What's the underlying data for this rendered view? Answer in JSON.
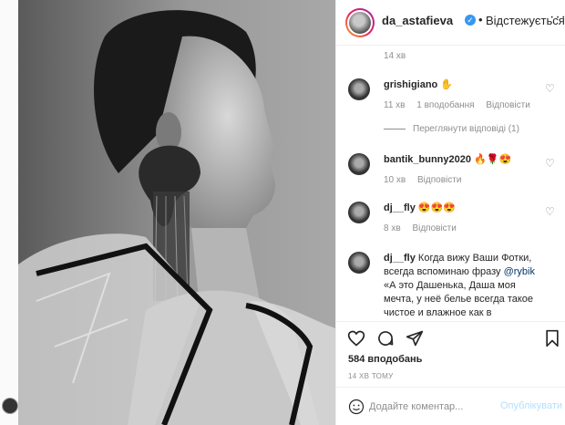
{
  "header": {
    "username": "da_astafieva",
    "separator": "•",
    "follow_status": "Відстежується",
    "more": "···"
  },
  "comments": {
    "top_timestamp": "14 хв",
    "items": [
      {
        "username": "grishigiano",
        "text": "✋",
        "time": "11 хв",
        "likes": "1 вподобання",
        "reply": "Відповісти",
        "view_replies": "Переглянути відповіді (1)"
      },
      {
        "username": "bantik_bunny2020",
        "text": "🔥🌹😍",
        "time": "10 хв",
        "reply": "Відповісти"
      },
      {
        "username": "dj__fly",
        "text": "😍😍😍",
        "time": "8 хв",
        "reply": "Відповісти"
      },
      {
        "username": "dj__fly",
        "text_before": "Когда вижу Ваши Фотки, всегда вспоминаю фразу",
        "mention": "@rybik",
        "text_after": "«А это Дашенька, Даша моя мечта, у неё белье всегда такое чистое и влажное как в"
      }
    ]
  },
  "actions": {
    "likes": "584 вподобань",
    "posted": "14 ХВ ТОМУ"
  },
  "add_comment": {
    "placeholder": "Додайте коментар...",
    "publish_label": "Опублікувати"
  },
  "colors": {
    "link": "#00376b",
    "verified": "#3897f0",
    "publish_disabled": "#b2dffc",
    "muted": "#8e8e8e"
  }
}
